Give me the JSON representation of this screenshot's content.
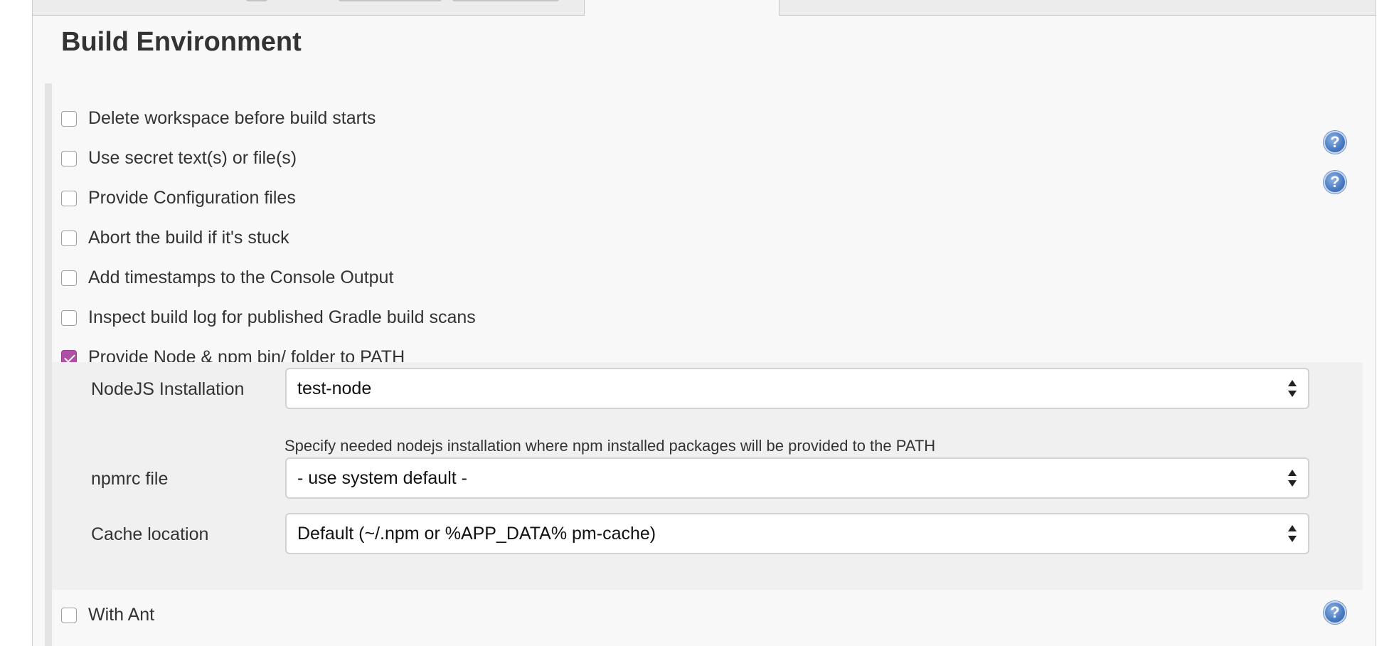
{
  "section": {
    "title": "Build Environment"
  },
  "options": [
    {
      "label": "Delete workspace before build starts",
      "checked": false,
      "help": false
    },
    {
      "label": "Use secret text(s) or file(s)",
      "checked": false,
      "help": true
    },
    {
      "label": "Provide Configuration files",
      "checked": false,
      "help": true
    },
    {
      "label": "Abort the build if it's stuck",
      "checked": false,
      "help": false
    },
    {
      "label": "Add timestamps to the Console Output",
      "checked": false,
      "help": false
    },
    {
      "label": "Inspect build log for published Gradle build scans",
      "checked": false,
      "help": false
    },
    {
      "label": "Provide Node & npm bin/ folder to PATH",
      "checked": true,
      "help": false
    },
    {
      "label": "With Ant",
      "checked": false,
      "help": true
    }
  ],
  "node_config": {
    "nodejs_installation": {
      "label": "NodeJS Installation",
      "value": "test-node",
      "help_text": "Specify needed nodejs installation where npm installed packages will be provided to the PATH"
    },
    "npmrc_file": {
      "label": "npmrc file",
      "value": "- use system default -"
    },
    "cache_location": {
      "label": "Cache location",
      "value": "Default (~/.npm or %APP_DATA% pm-cache)"
    }
  },
  "icons": {
    "help": "help-icon",
    "checkbox": "checkbox-icon"
  },
  "colors": {
    "checkbox_checked": "#b04fa5",
    "help_icon": "#4d7ec6",
    "panel_background": "#f8f8f8",
    "subsection_background": "#f0f0f0"
  }
}
